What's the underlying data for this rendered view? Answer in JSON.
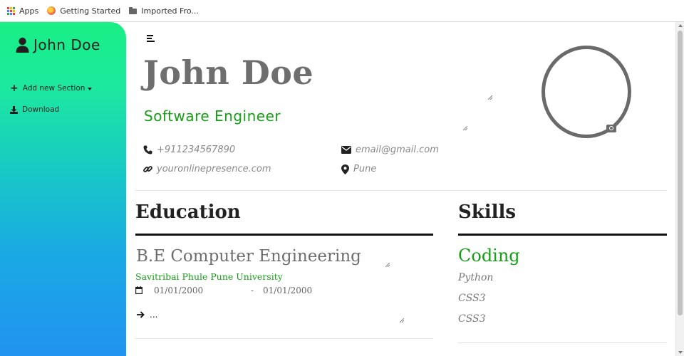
{
  "bookmarks": {
    "apps": "Apps",
    "getting_started": "Getting Started",
    "imported": "Imported Fro..."
  },
  "sidebar": {
    "name": "John Doe",
    "add_section": "Add new Section",
    "download": "Download"
  },
  "header": {
    "name": "John Doe",
    "job_title": "Software Engineer"
  },
  "contact": {
    "phone": "+911234567890",
    "email": "email@gmail.com",
    "website": "youronlinepresence.com",
    "location": "Pune"
  },
  "education": {
    "title": "Education",
    "degree": "B.E Computer Engineering",
    "university": "Savitribai Phule Pune University",
    "start_date": "01/01/2000",
    "date_separator": "-",
    "end_date": "01/01/2000",
    "description": "..."
  },
  "skills": {
    "title": "Skills",
    "category": "Coding",
    "items": [
      "Python",
      "CSS3",
      "CSS3"
    ]
  },
  "colors": {
    "accent_green": "#16a016",
    "sidebar_top": "#19ef84",
    "sidebar_bottom": "#2193f0",
    "name_gray": "#6e6e6e"
  },
  "icons": {
    "phone": "phone-icon",
    "email": "envelope-icon",
    "website": "link-icon",
    "location": "map-pin-icon",
    "calendar": "calendar-icon",
    "arrow": "arrow-right-icon",
    "camera": "camera-icon",
    "user": "user-icon",
    "download": "download-icon",
    "plus": "plus-icon",
    "menu": "menu-icon"
  }
}
